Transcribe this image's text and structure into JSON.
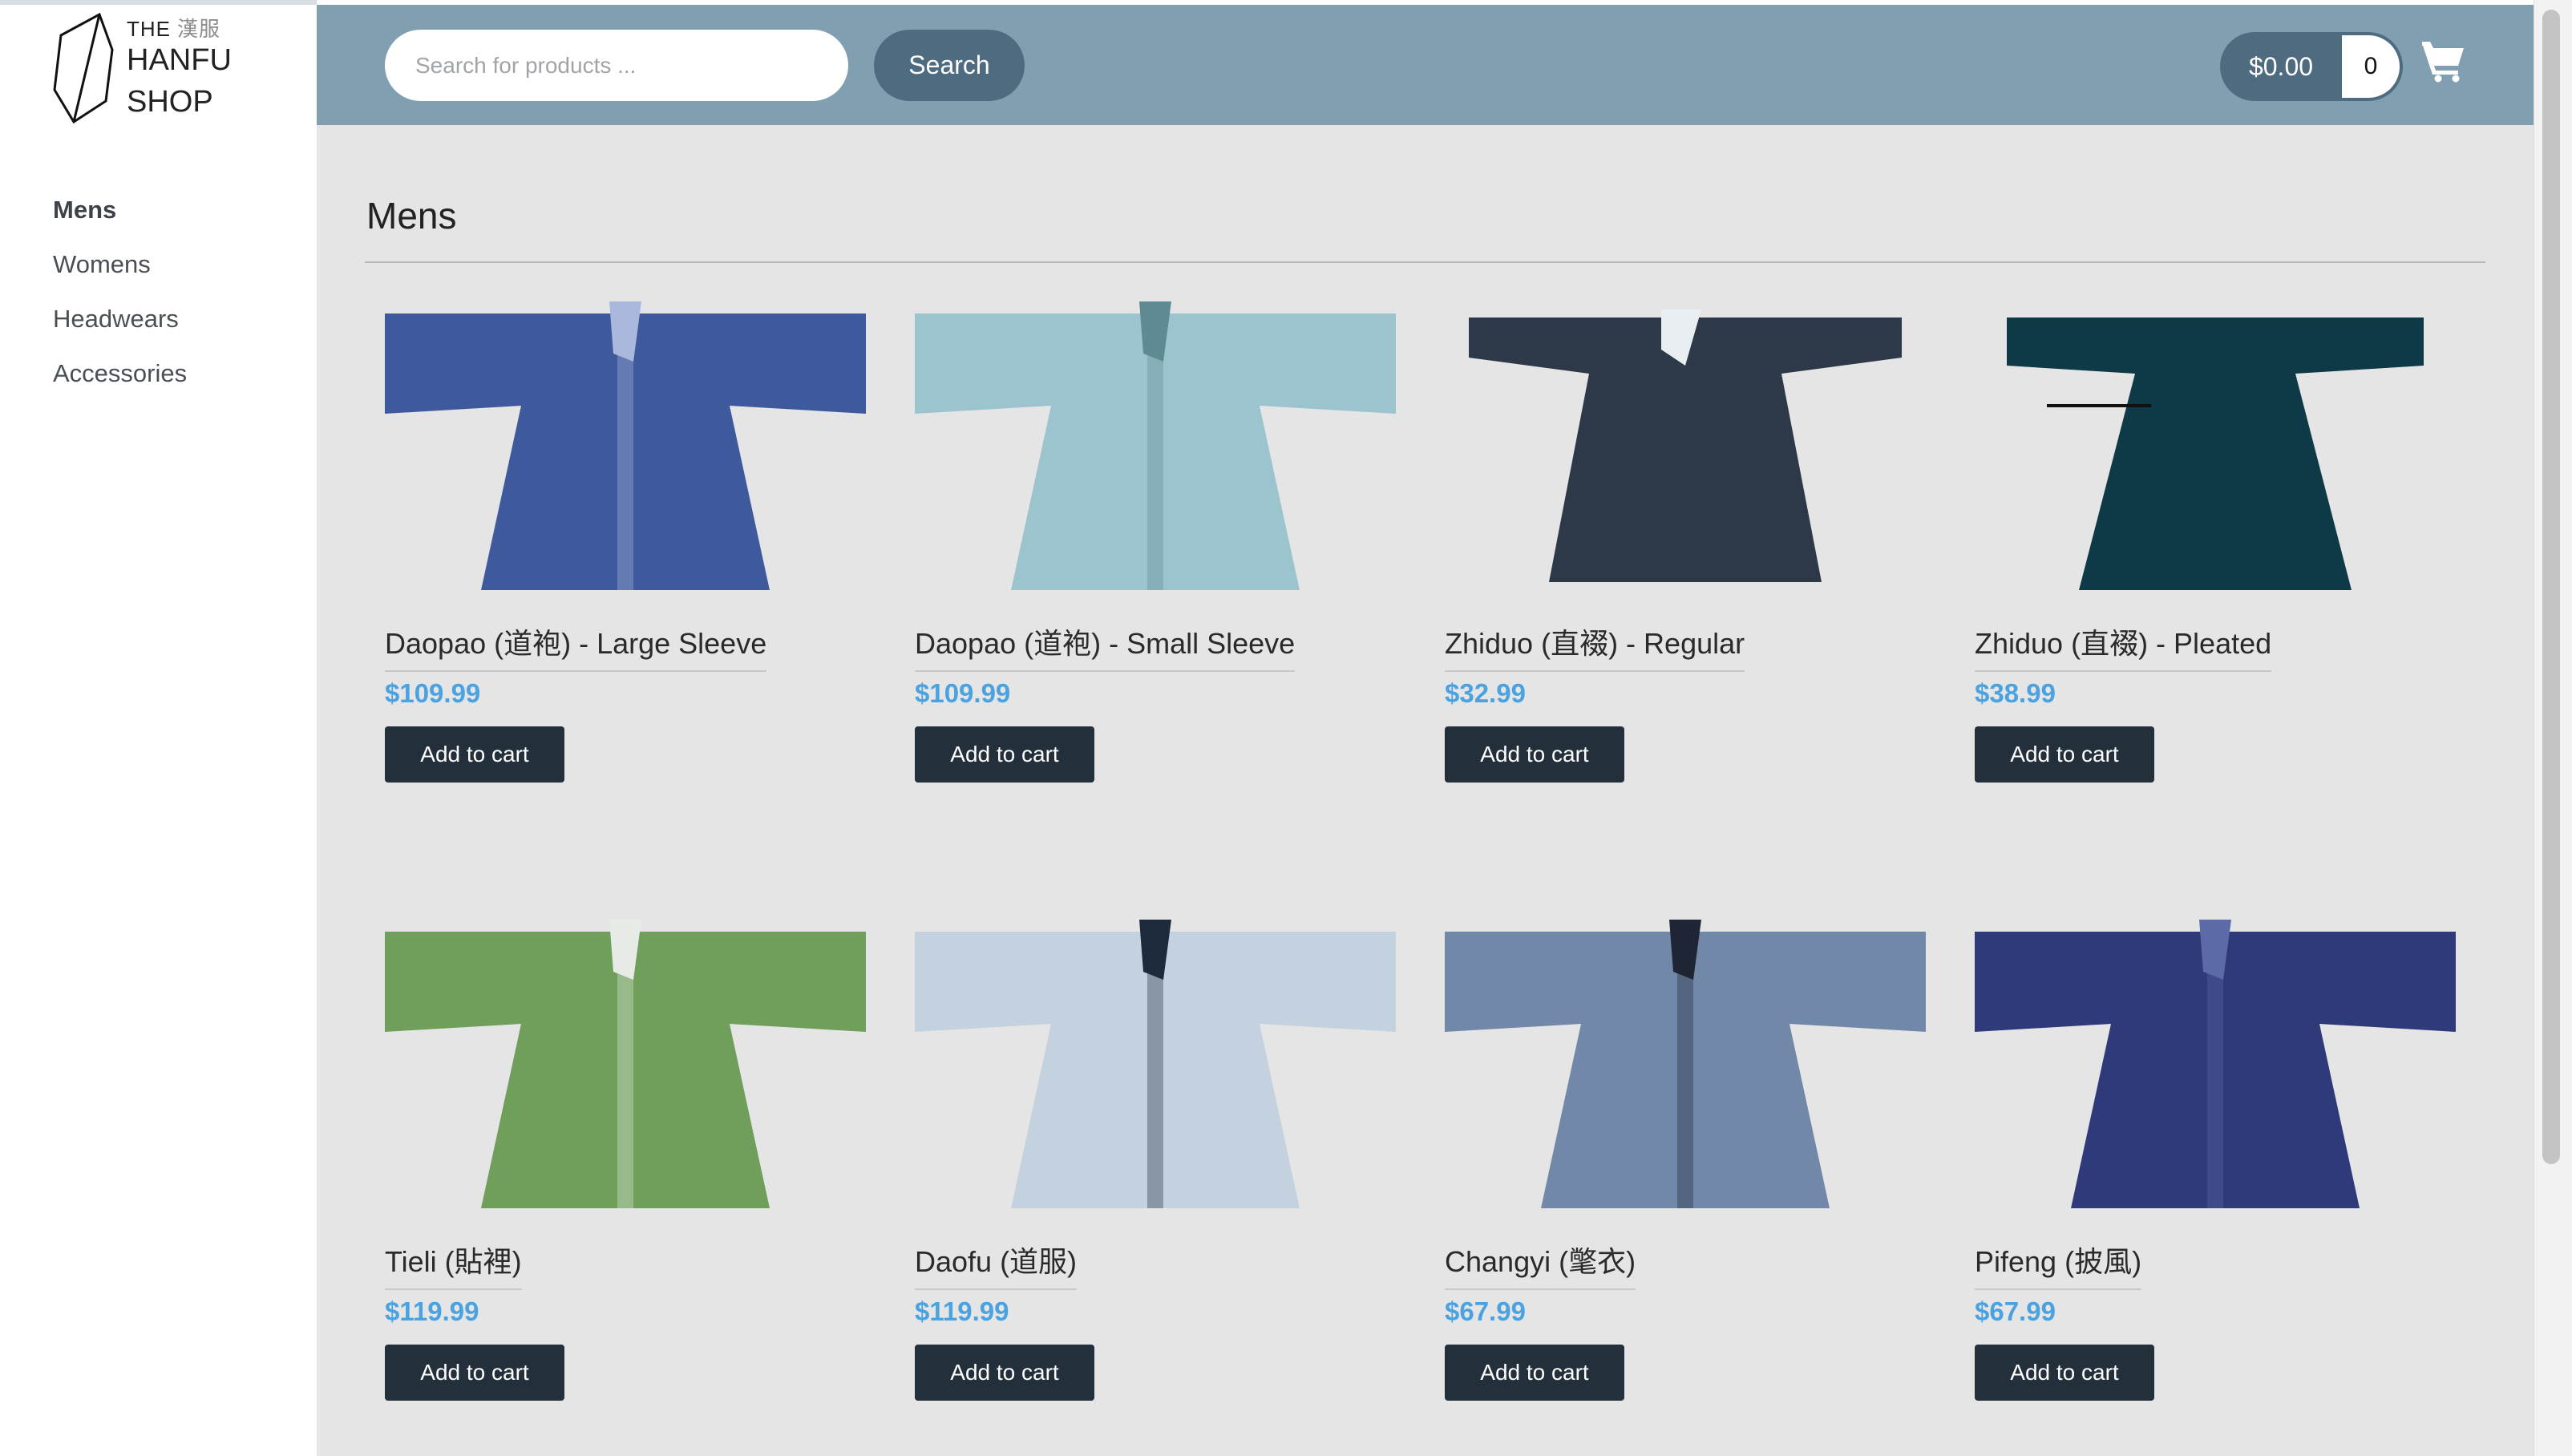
{
  "brand": {
    "line1": "THE",
    "line1_cn": "漢服",
    "line2": "HANFU",
    "line3": "SHOP"
  },
  "search": {
    "placeholder": "Search for products ...",
    "button_label": "Search"
  },
  "cart": {
    "total": "$0.00",
    "count": "0",
    "icon": "shopping-cart-icon"
  },
  "sidebar": {
    "items": [
      {
        "label": "Mens",
        "active": true
      },
      {
        "label": "Womens",
        "active": false
      },
      {
        "label": "Headwears",
        "active": false
      },
      {
        "label": "Accessories",
        "active": false
      }
    ]
  },
  "page": {
    "title": "Mens"
  },
  "products": [
    {
      "name": "Daopao (道袍) - Large Sleeve",
      "price": "$109.99",
      "button": "Add to cart",
      "color": "#3f5a9c",
      "trim": "#a9b8dc"
    },
    {
      "name": "Daopao (道袍) - Small Sleeve",
      "price": "$109.99",
      "button": "Add to cart",
      "color": "#9cc4cf",
      "trim": "#5f8a93"
    },
    {
      "name": "Zhiduo (直裰) - Regular",
      "price": "$32.99",
      "button": "Add to cart",
      "color": "#2d3848",
      "trim": "#e9eef2"
    },
    {
      "name": "Zhiduo (直裰) - Pleated",
      "price": "$38.99",
      "button": "Add to cart",
      "color": "#0e3a48",
      "trim": "#0e3a48"
    },
    {
      "name": "Tieli (貼裡)",
      "price": "$119.99",
      "button": "Add to cart",
      "color": "#6f9f5a",
      "trim": "#e6ebe6"
    },
    {
      "name": "Daofu (道服)",
      "price": "$119.99",
      "button": "Add to cart",
      "color": "#c3d2de",
      "trim": "#1c2a3c"
    },
    {
      "name": "Changyi (氅衣)",
      "price": "$67.99",
      "button": "Add to cart",
      "color": "#7288a8",
      "trim": "#1e2534"
    },
    {
      "name": "Pifeng (披風)",
      "price": "$67.99",
      "button": "Add to cart",
      "color": "#2e3a7a",
      "trim": "#5c6aa8"
    }
  ]
}
